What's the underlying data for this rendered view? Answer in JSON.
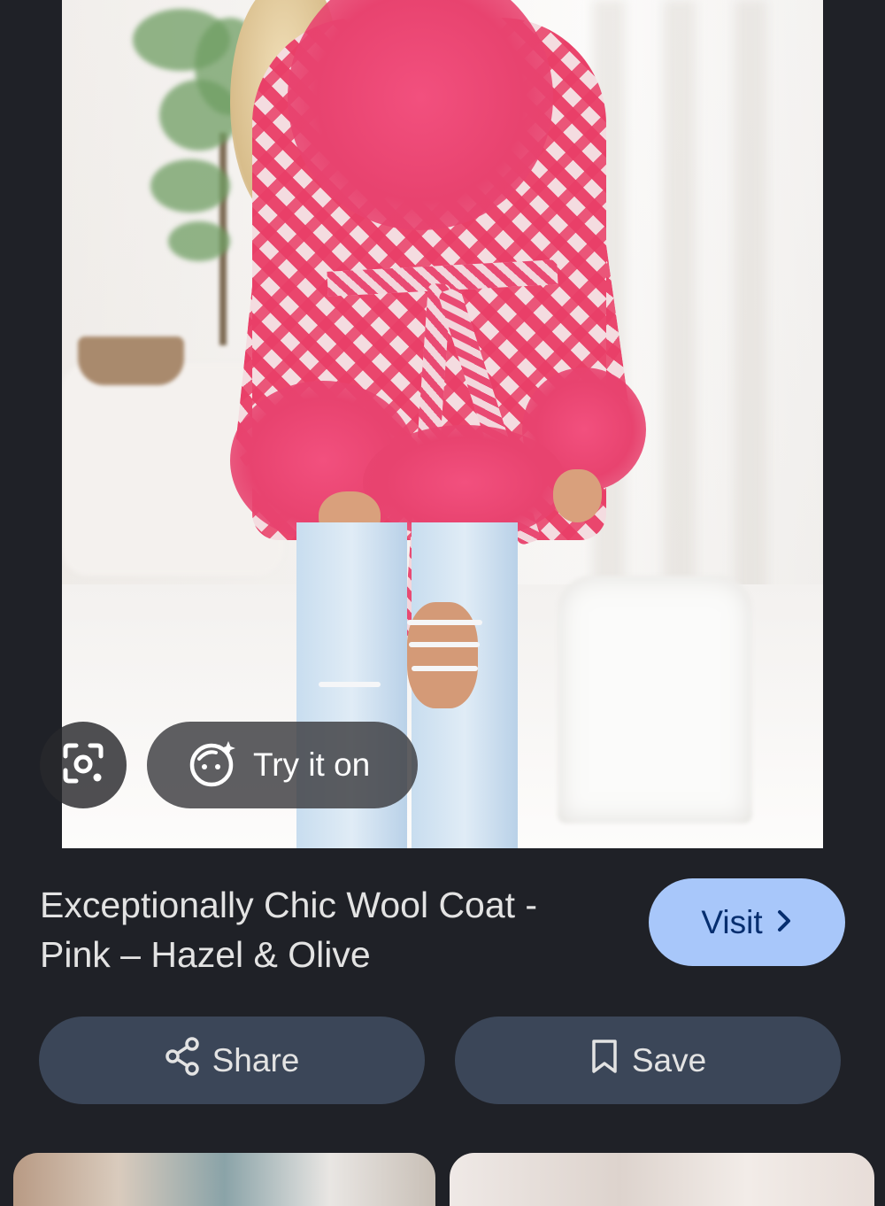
{
  "result": {
    "overlay": {
      "lens_icon": "google-lens-icon",
      "tryon_icon": "try-on-face-sparkle-icon",
      "tryon_label": "Try it on"
    },
    "title": "Exceptionally Chic Wool Coat - Pink – Hazel & Olive",
    "visit_label": "Visit",
    "share_label": "Share",
    "save_label": "Save"
  },
  "colors": {
    "background": "#1f2127",
    "visit_button": "#a8c7fa",
    "action_button": "#3b4658",
    "coat_pink": "#e94a73"
  }
}
